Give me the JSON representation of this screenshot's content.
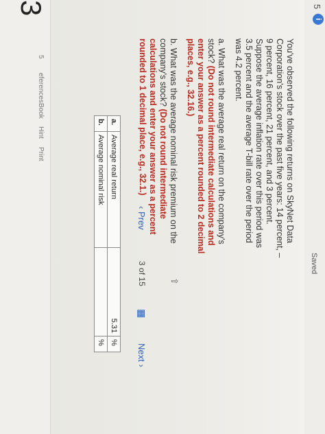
{
  "header": {
    "counter": "5",
    "info_icon": "info-icon",
    "saved": "Saved"
  },
  "question": {
    "number": "3",
    "intro": "You've observed the following returns on SkyNet Data Corporation's stock over the past five years: 14 percent, –9 percent, 16 percent, 21 percent, and 3 percent. Suppose the average inflation rate over this period was 3.5 percent and the average T-bill rate over the period was 4.2 percent.",
    "part_a_text": "a. What was the average real return on the company's stock?",
    "part_a_instr": "(Do not round intermediate calculations and enter your answer as a percent rounded to 2 decimal places, e.g., 32.16.)",
    "part_b_text": "b. What was the average nominal risk premium on the company's stock?",
    "part_b_instr": "(Do not round intermediate calculations and enter your answer as a percent rounded to 1 decimal place, e.g., 32.1.)"
  },
  "answers": {
    "rows": [
      {
        "key": "a.",
        "label": "Average real return",
        "value": "5.31",
        "unit": "%"
      },
      {
        "key": "b.",
        "label": "Average nominal risk",
        "value": "",
        "unit": "%"
      }
    ]
  },
  "sidebar": {
    "items": [
      "Book",
      "Hint",
      "Print",
      "eferences"
    ],
    "counter": "5"
  },
  "nav": {
    "prev": "Prev",
    "page": "3",
    "of": "of",
    "total": "15",
    "next": "Next"
  }
}
